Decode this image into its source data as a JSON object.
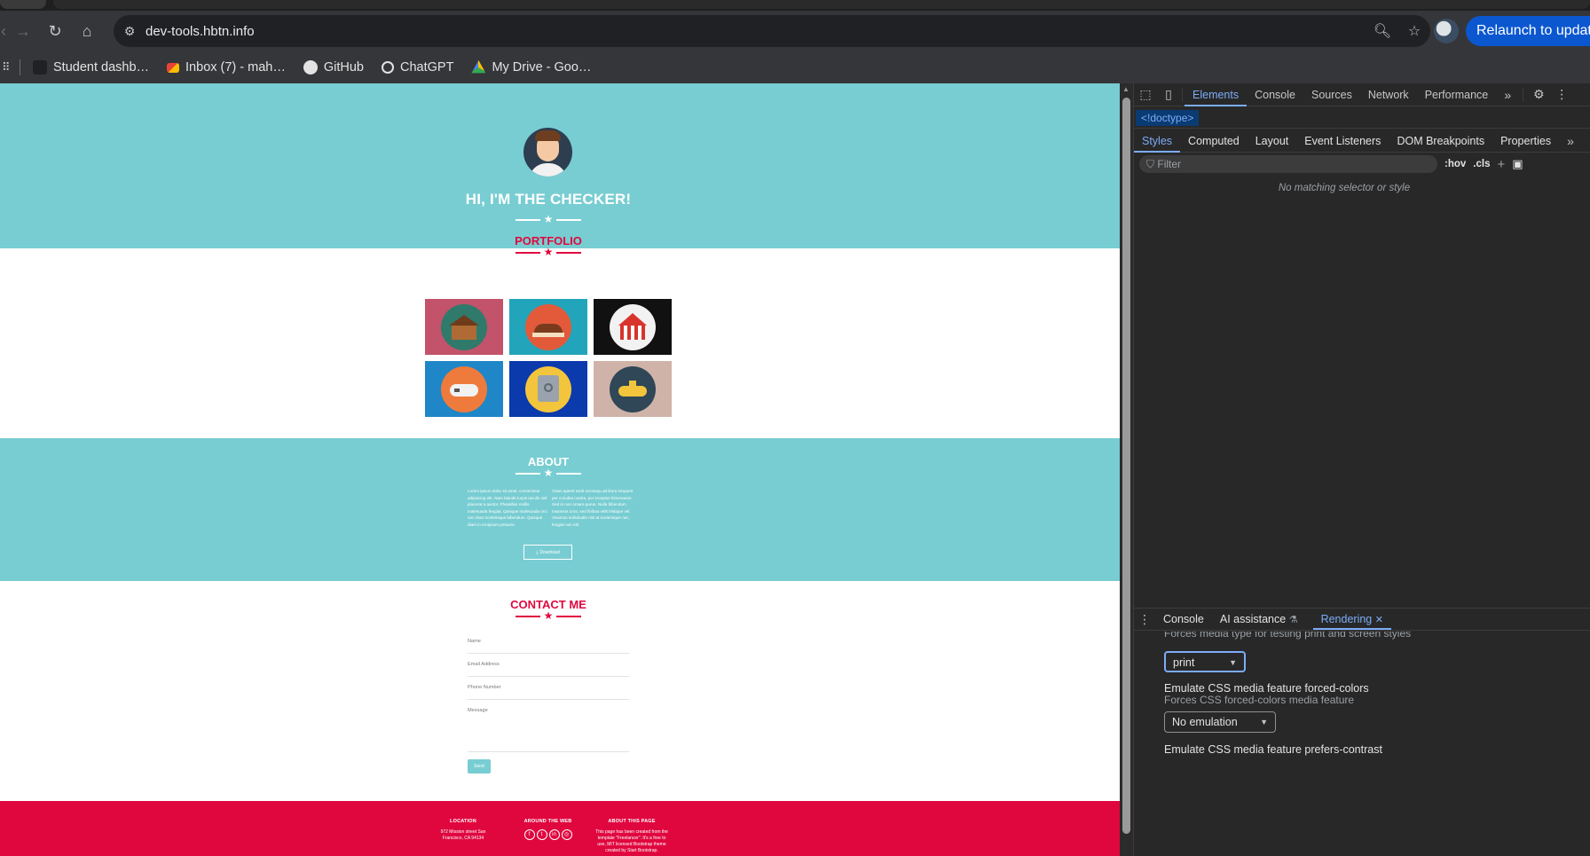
{
  "browser": {
    "url": "dev-tools.hbtn.info",
    "relaunch_label": "Relaunch to update",
    "bookmarks": [
      {
        "label": "Student dashb…",
        "icon": "bookmark-icon"
      },
      {
        "label": "Inbox (7) - mah…",
        "icon": "gmail-icon"
      },
      {
        "label": "GitHub",
        "icon": "github-icon"
      },
      {
        "label": "ChatGPT",
        "icon": "chatgpt-icon"
      },
      {
        "label": "My Drive - Goo…",
        "icon": "drive-icon"
      }
    ]
  },
  "page": {
    "hero_title": "HI, I'M THE CHECKER!",
    "portfolio_title": "PORTFOLIO",
    "portfolio_items": [
      {
        "icon": "cabin-icon",
        "bg": "#c2536a"
      },
      {
        "icon": "cake-icon",
        "bg": "#22a5ba"
      },
      {
        "icon": "circus-icon",
        "bg": "#111111"
      },
      {
        "icon": "game-controller-icon",
        "bg": "#1f86c7"
      },
      {
        "icon": "safe-icon",
        "bg": "#0b3aad"
      },
      {
        "icon": "submarine-icon",
        "bg": "#cfb3a8"
      }
    ],
    "about_title": "ABOUT",
    "about_left": "Lorem ipsum dolor sit amet, consectetur adipiscing elit. Nam blandit turpis iaculis nisl placerat a auctor. Phasellus mollis malesuada feugiat. Quisque malesuada orci non risus scelerisque bibendum. Quisque diam in eroipsum posuere.",
    "about_right": "Class aptent taciti sociosqu ad litora torquent per conubia nostra, per inceptos himenaeos. Sed in non ornare purus. Nulla bibendum maximus urna, sed finibus velit tristique vel. Vivamus sollicitudin nisl at scelerisque nec, feugiat non elit.",
    "download_label": "Download",
    "contact_title": "CONTACT ME",
    "fields": [
      "Name",
      "Email Address",
      "Phone Number",
      "Message"
    ],
    "send_label": "Send",
    "footer": {
      "location_title": "LOCATION",
      "location_text": "972 Mission street San Francisco, CA 94134",
      "web_title": "AROUND THE WEB",
      "about_title": "ABOUT THIS PAGE",
      "about_text": "This page has been created from the template \"Freelancer\". It's a free to use, MIT licensed Bootstrap theme created by Start Bootstrap."
    },
    "colors": {
      "teal": "#78cdd2",
      "red": "#e0073f"
    }
  },
  "devtools": {
    "tabs": [
      "Elements",
      "Console",
      "Sources",
      "Network",
      "Performance"
    ],
    "active_tab": "Elements",
    "breadcrumb": "<!doctype>",
    "subtabs": [
      "Styles",
      "Computed",
      "Layout",
      "Event Listeners",
      "DOM Breakpoints",
      "Properties"
    ],
    "active_subtab": "Styles",
    "filter_placeholder": "Filter",
    "hov_label": ":hov",
    "cls_label": ".cls",
    "no_match": "No matching selector or style",
    "drawer_tabs": [
      "Console",
      "AI assistance",
      "Rendering"
    ],
    "active_drawer_tab": "Rendering",
    "rendering": {
      "media_desc": "Forces media type for testing print and screen styles",
      "media_value": "print",
      "forced_colors_title": "Emulate CSS media feature forced-colors",
      "forced_colors_desc": "Forces CSS forced-colors media feature",
      "forced_colors_value": "No emulation",
      "contrast_title": "Emulate CSS media feature prefers-contrast"
    }
  }
}
